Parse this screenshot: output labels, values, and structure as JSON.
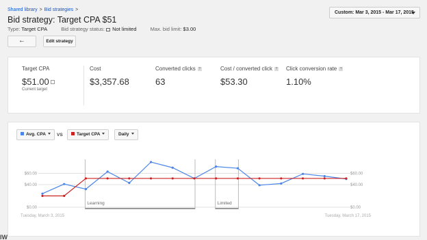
{
  "breadcrumb": {
    "library": "Shared library",
    "strategies": "Bid strategies",
    "sep": ">"
  },
  "page_title": "Bid strategy: Target CPA $51",
  "meta": {
    "type_label": "Type:",
    "type_value": "Target CPA",
    "status_label": "Bid strategy status:",
    "status_value": "Not limited",
    "maxbid_label": "Max. bid limit:",
    "maxbid_value": "$3.00"
  },
  "date_range": "Custom: Mar 3, 2015 - Mar 17, 2015",
  "buttons": {
    "back": "←",
    "edit": "Edit strategy"
  },
  "stats": [
    {
      "label": "Target CPA",
      "value": "$51.00",
      "sub": "Current target"
    },
    {
      "label": "Cost",
      "value": "$3,357.68"
    },
    {
      "label": "Converted clicks",
      "value": "63",
      "help": "?"
    },
    {
      "label": "Cost / converted click",
      "value": "$53.30",
      "help": "?"
    },
    {
      "label": "Click conversion rate",
      "value": "1.10%",
      "help": "?"
    }
  ],
  "chart_controls": {
    "metric1": "Avg. CPA",
    "vs": "VS",
    "metric2": "Target CPA",
    "granularity": "Daily",
    "metric1_color": "#4a86e8",
    "metric2_color": "#cc2222"
  },
  "chart_data": {
    "type": "line",
    "x": [
      "2015-03-03",
      "2015-03-04",
      "2015-03-05",
      "2015-03-06",
      "2015-03-07",
      "2015-03-08",
      "2015-03-09",
      "2015-03-10",
      "2015-03-11",
      "2015-03-12",
      "2015-03-13",
      "2015-03-14",
      "2015-03-15",
      "2015-03-16",
      "2015-03-17"
    ],
    "series": [
      {
        "name": "Avg. CPA",
        "color": "#4a86e8",
        "values": [
          24,
          41,
          32,
          63,
          43,
          80,
          70,
          51,
          72,
          69,
          39,
          42,
          59,
          55,
          50
        ]
      },
      {
        "name": "Target CPA",
        "color": "#cc2222",
        "values": [
          20,
          20,
          51,
          51,
          51,
          51,
          51,
          51,
          51,
          51,
          51,
          51,
          51,
          51,
          51
        ]
      }
    ],
    "ylim": [
      0,
      80
    ],
    "yticks": [
      "$0.00",
      "$40.00",
      "$60.00"
    ],
    "ytick_values": [
      0,
      40,
      60
    ],
    "x_start_label": "Tuesday, March 3, 2015",
    "x_end_label": "Tuesday, March 17, 2015",
    "periods": [
      {
        "label": "Learning",
        "start": 2,
        "end": 7
      },
      {
        "label": "Limited",
        "start": 8,
        "end": 9
      }
    ],
    "grid": true,
    "legend": "none"
  },
  "footer_text": "IW"
}
